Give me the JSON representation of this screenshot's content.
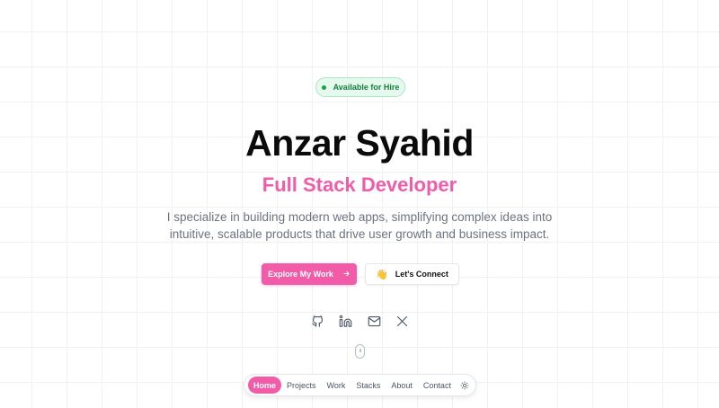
{
  "hero": {
    "badge": "Available for Hire",
    "name": "Anzar Syahid",
    "role": "Full Stack Developer",
    "description": "I specialize in building modern web apps, simplifying complex ideas into intuitive, scalable products that drive user growth and business impact.",
    "primary_button": "Explore My Work",
    "primary_button_icon": "arrow-right-icon",
    "secondary_button": "Let's Connect",
    "secondary_button_icon": "waving-hand-icon",
    "socials": [
      "github-icon",
      "linkedin-icon",
      "mail-icon",
      "x-icon"
    ]
  },
  "nav": {
    "items": [
      {
        "label": "Home",
        "active": true
      },
      {
        "label": "Projects",
        "active": false
      },
      {
        "label": "Work",
        "active": false
      },
      {
        "label": "Stacks",
        "active": false
      },
      {
        "label": "About",
        "active": false
      },
      {
        "label": "Contact",
        "active": false
      }
    ],
    "theme_toggle_icon": "sun-icon"
  },
  "colors": {
    "accent": "#f25ba8",
    "badge_bg": "#e6f9ee",
    "badge_text": "#15803d",
    "text_muted": "#6b7280"
  }
}
